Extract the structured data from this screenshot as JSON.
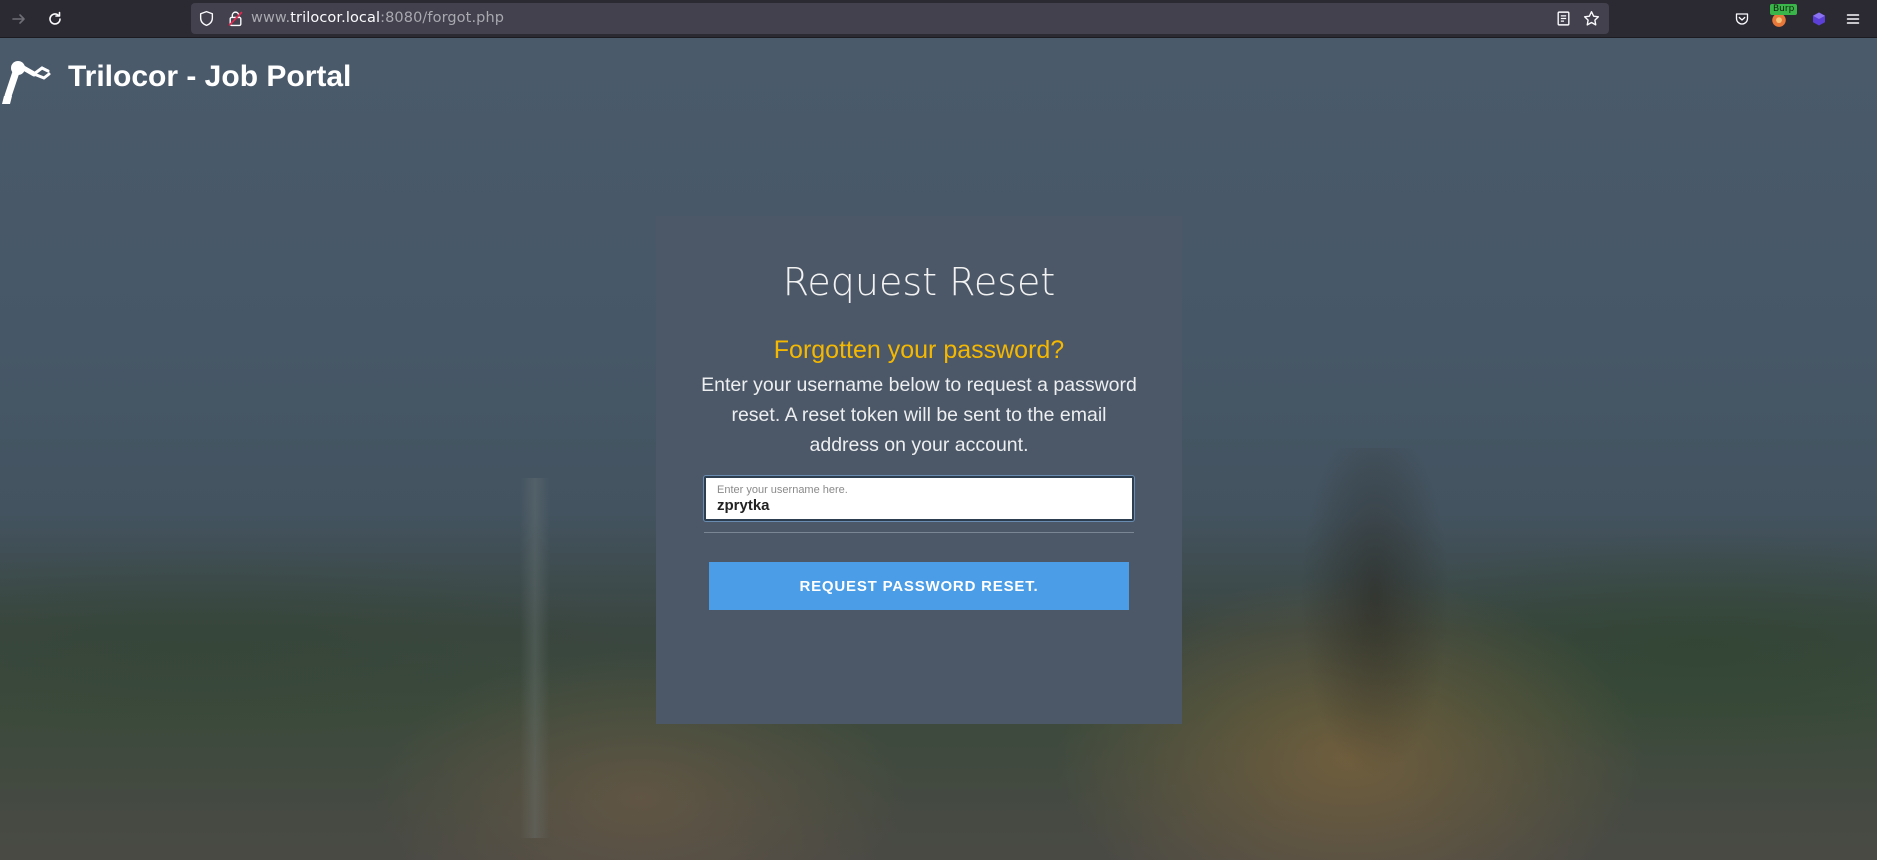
{
  "browser": {
    "url_prefix": "www.",
    "url_host": "trilocor.local",
    "url_rest": ":8080/forgot.php",
    "burp_badge": "Burp",
    "icons": {
      "back": "arrow-right-icon",
      "reload": "reload-icon",
      "shield": "shield-icon",
      "lock": "lock-warning-icon",
      "reader": "reader-view-icon",
      "bookmark": "star-icon",
      "pocket": "pocket-icon",
      "burp": "burp-icon",
      "extension": "extension-cube-icon",
      "menu": "hamburger-menu-icon"
    }
  },
  "header": {
    "brand": "Trilocor - Job Portal",
    "logo": "robot-arm-icon"
  },
  "card": {
    "title": "Request Reset",
    "subtitle": "Forgotten your password?",
    "description": "Enter your username below to request a password reset. A reset token will be sent to the email address on your account.",
    "username_label": "Enter your username here.",
    "username_value": "zprytka",
    "submit_label": "REQUEST PASSWORD RESET."
  },
  "colors": {
    "accent_yellow": "#f5b800",
    "button_blue": "#4a9de6",
    "card_bg": "#4c5868"
  }
}
